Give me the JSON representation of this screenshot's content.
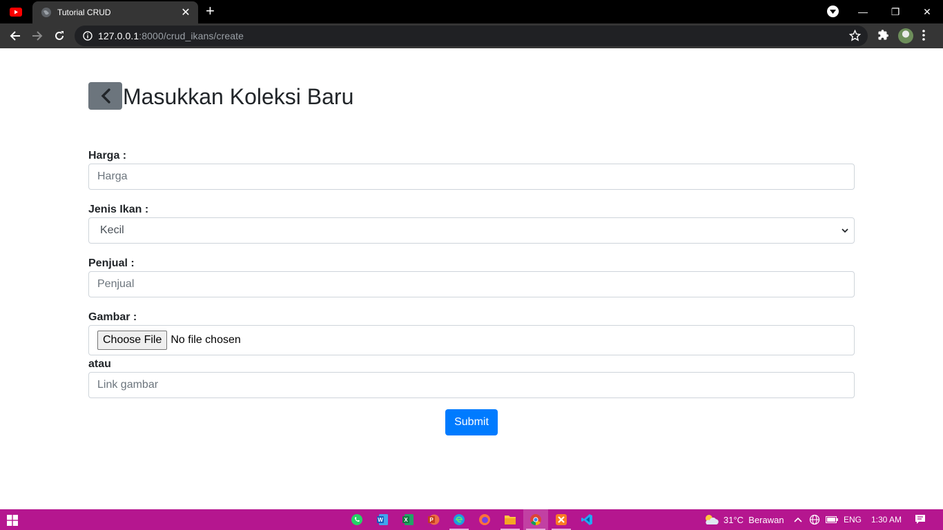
{
  "browser": {
    "tab_title": "Tutorial CRUD",
    "tab_close": "✕",
    "new_tab": "+",
    "url_host": "127.0.0.1",
    "url_rest": ":8000/crud_ikans/create",
    "window_controls": {
      "minimize": "—",
      "restore": "❐",
      "close": "✕"
    }
  },
  "page": {
    "title": "Masukkan Koleksi Baru",
    "harga_label": "Harga :",
    "harga_placeholder": "Harga",
    "jenis_label": "Jenis Ikan :",
    "jenis_selected": "Kecil",
    "penjual_label": "Penjual :",
    "penjual_placeholder": "Penjual",
    "gambar_label": "Gambar :",
    "file_button": "Choose File",
    "file_status": "No file chosen",
    "atau_label": "atau",
    "link_placeholder": "Link gambar",
    "submit_label": "Submit"
  },
  "taskbar": {
    "weather": "31°C  Berawan",
    "language": "ENG",
    "time": "1:30 AM",
    "colors": {
      "bar": "#b5168f"
    }
  }
}
